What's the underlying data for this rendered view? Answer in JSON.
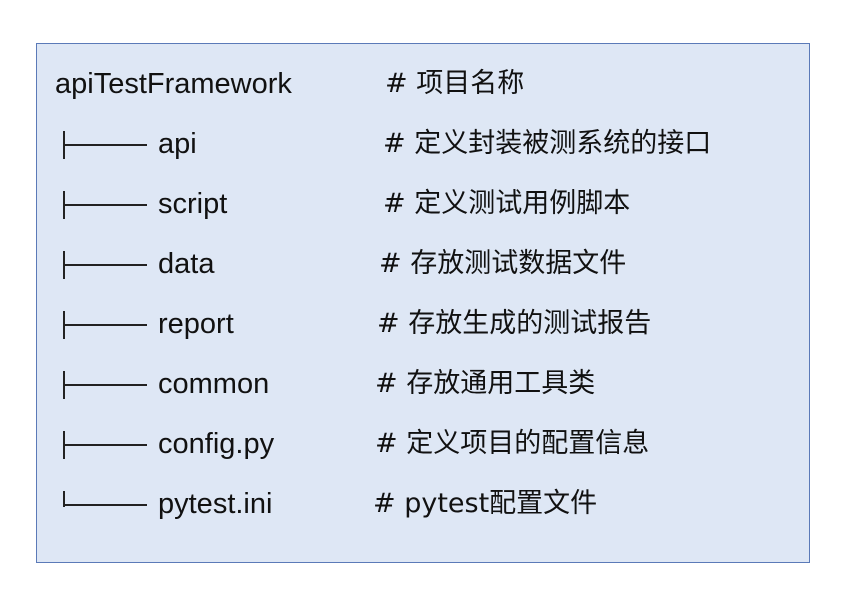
{
  "root": {
    "name": "apiTestFramework",
    "comment": "# 项目名称"
  },
  "items": [
    {
      "name": "api",
      "comment": "# 定义封装被测系统的接口"
    },
    {
      "name": "script",
      "comment": "# 定义测试用例脚本"
    },
    {
      "name": "data",
      "comment": "# 存放测试数据文件"
    },
    {
      "name": "report",
      "comment": "# 存放生成的测试报告"
    },
    {
      "name": "common",
      "comment": "# 存放通用工具类"
    },
    {
      "name": "config.py",
      "comment": "# 定义项目的配置信息"
    },
    {
      "name": "pytest.ini",
      "comment": "# pytest配置文件"
    }
  ]
}
